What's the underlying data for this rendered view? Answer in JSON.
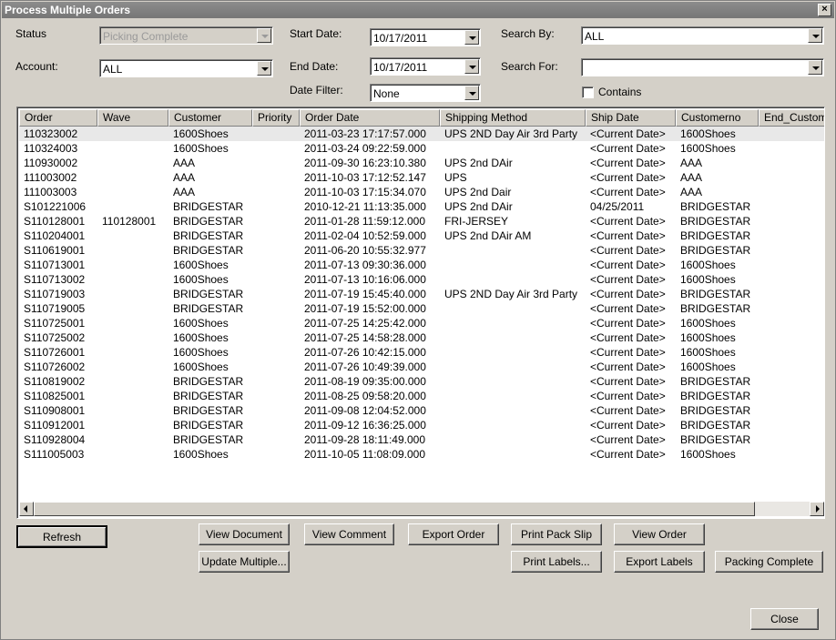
{
  "window": {
    "title": "Process Multiple Orders",
    "close_glyph": "×"
  },
  "filters": {
    "status_label": "Status",
    "status_value": "Picking Complete",
    "account_label": "Account:",
    "account_value": "ALL",
    "start_date_label": "Start Date:",
    "start_date_value": "10/17/2011",
    "end_date_label": "End Date:",
    "end_date_value": "10/17/2011",
    "date_filter_label": "Date Filter:",
    "date_filter_value": "None",
    "search_by_label": "Search By:",
    "search_by_value": "ALL",
    "search_for_label": "Search For:",
    "search_for_value": "",
    "contains_label": "Contains"
  },
  "table": {
    "columns": [
      "Order",
      "Wave",
      "Customer",
      "Priority",
      "Order Date",
      "Shipping Method",
      "Ship Date",
      "Customerno",
      "End_Customer"
    ],
    "rows": [
      [
        "110323002",
        "",
        "1600Shoes",
        "",
        "2011-03-23 17:17:57.000",
        "UPS 2ND Day Air 3rd Party",
        "<Current Date>",
        "1600Shoes",
        ""
      ],
      [
        "110324003",
        "",
        "1600Shoes",
        "",
        "2011-03-24 09:22:59.000",
        "",
        "<Current Date>",
        "1600Shoes",
        ""
      ],
      [
        "110930002",
        "",
        "AAA",
        "",
        "2011-09-30 16:23:10.380",
        "UPS 2nd DAir",
        "<Current Date>",
        "AAA",
        ""
      ],
      [
        "111003002",
        "",
        "AAA",
        "",
        "2011-10-03 17:12:52.147",
        "UPS",
        "<Current Date>",
        "AAA",
        ""
      ],
      [
        "111003003",
        "",
        "AAA",
        "",
        "2011-10-03 17:15:34.070",
        "UPS 2nd Dair",
        "<Current Date>",
        "AAA",
        ""
      ],
      [
        "S101221006",
        "",
        "BRIDGESTAR",
        "",
        "2010-12-21 11:13:35.000",
        "UPS 2nd DAir",
        "04/25/2011",
        "BRIDGESTAR",
        ""
      ],
      [
        "S110128001",
        "110128001",
        "BRIDGESTAR",
        "",
        "2011-01-28 11:59:12.000",
        "FRI-JERSEY",
        "<Current Date>",
        "BRIDGESTAR",
        ""
      ],
      [
        "S110204001",
        "",
        "BRIDGESTAR",
        "",
        "2011-02-04 10:52:59.000",
        "UPS 2nd DAir AM",
        "<Current Date>",
        "BRIDGESTAR",
        ""
      ],
      [
        "S110619001",
        "",
        "BRIDGESTAR",
        "",
        "2011-06-20 10:55:32.977",
        "",
        "<Current Date>",
        "BRIDGESTAR",
        ""
      ],
      [
        "S110713001",
        "",
        "1600Shoes",
        "",
        "2011-07-13 09:30:36.000",
        "",
        "<Current Date>",
        "1600Shoes",
        ""
      ],
      [
        "S110713002",
        "",
        "1600Shoes",
        "",
        "2011-07-13 10:16:06.000",
        "",
        "<Current Date>",
        "1600Shoes",
        ""
      ],
      [
        "S110719003",
        "",
        "BRIDGESTAR",
        "",
        "2011-07-19 15:45:40.000",
        "UPS 2ND Day Air 3rd Party",
        "<Current Date>",
        "BRIDGESTAR",
        ""
      ],
      [
        "S110719005",
        "",
        "BRIDGESTAR",
        "",
        "2011-07-19 15:52:00.000",
        "",
        "<Current Date>",
        "BRIDGESTAR",
        ""
      ],
      [
        "S110725001",
        "",
        "1600Shoes",
        "",
        "2011-07-25 14:25:42.000",
        "",
        "<Current Date>",
        "1600Shoes",
        ""
      ],
      [
        "S110725002",
        "",
        "1600Shoes",
        "",
        "2011-07-25 14:58:28.000",
        "",
        "<Current Date>",
        "1600Shoes",
        ""
      ],
      [
        "S110726001",
        "",
        "1600Shoes",
        "",
        "2011-07-26 10:42:15.000",
        "",
        "<Current Date>",
        "1600Shoes",
        ""
      ],
      [
        "S110726002",
        "",
        "1600Shoes",
        "",
        "2011-07-26 10:49:39.000",
        "",
        "<Current Date>",
        "1600Shoes",
        ""
      ],
      [
        "S110819002",
        "",
        "BRIDGESTAR",
        "",
        "2011-08-19 09:35:00.000",
        "",
        "<Current Date>",
        "BRIDGESTAR",
        ""
      ],
      [
        "S110825001",
        "",
        "BRIDGESTAR",
        "",
        "2011-08-25 09:58:20.000",
        "",
        "<Current Date>",
        "BRIDGESTAR",
        ""
      ],
      [
        "S110908001",
        "",
        "BRIDGESTAR",
        "",
        "2011-09-08 12:04:52.000",
        "",
        "<Current Date>",
        "BRIDGESTAR",
        ""
      ],
      [
        "S110912001",
        "",
        "BRIDGESTAR",
        "",
        "2011-09-12 16:36:25.000",
        "",
        "<Current Date>",
        "BRIDGESTAR",
        ""
      ],
      [
        "S110928004",
        "",
        "BRIDGESTAR",
        "",
        "2011-09-28 18:11:49.000",
        "",
        "<Current Date>",
        "BRIDGESTAR",
        ""
      ],
      [
        "S111005003",
        "",
        "1600Shoes",
        "",
        "2011-10-05 11:08:09.000",
        "",
        "<Current Date>",
        "1600Shoes",
        ""
      ]
    ]
  },
  "buttons": {
    "refresh": "Refresh",
    "view_document": "View Document",
    "view_comment": "View Comment",
    "export_order": "Export Order",
    "print_pack_slip": "Print Pack Slip",
    "view_order": "View Order",
    "update_multiple": "Update Multiple...",
    "print_labels": "Print Labels...",
    "export_labels": "Export Labels",
    "packing_complete": "Packing Complete",
    "close": "Close"
  }
}
